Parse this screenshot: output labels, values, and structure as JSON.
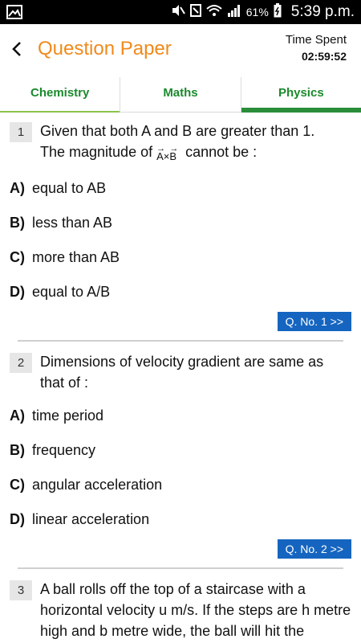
{
  "status_bar": {
    "battery": "61%",
    "time": "5:39 p.m."
  },
  "header": {
    "title": "Question Paper",
    "timer_label": "Time Spent",
    "timer_value": "02:59:52"
  },
  "tabs": [
    {
      "label": "Chemistry"
    },
    {
      "label": "Maths"
    },
    {
      "label": "Physics",
      "active": true
    }
  ],
  "questions": [
    {
      "number": "1",
      "text_line1": "Given that both A and B are greater than 1.",
      "text_line2_pre": "The magnitude of",
      "text_line2_vec_a": "A",
      "text_line2_cross": "×",
      "text_line2_vec_b": "B",
      "text_line2_post": "cannot be :",
      "options": [
        {
          "label": "A)",
          "text": "equal to AB"
        },
        {
          "label": "B)",
          "text": "less than AB"
        },
        {
          "label": "C)",
          "text": "more than AB"
        },
        {
          "label": "D)",
          "text": "equal to A/B"
        }
      ],
      "button": "Q. No. 1 >>"
    },
    {
      "number": "2",
      "text": "Dimensions of velocity gradient are same as that of :",
      "options": [
        {
          "label": "A)",
          "text": "time period"
        },
        {
          "label": "B)",
          "text": "frequency"
        },
        {
          "label": "C)",
          "text": "angular acceleration"
        },
        {
          "label": "D)",
          "text": "linear acceleration"
        }
      ],
      "button": "Q. No. 2 >>"
    },
    {
      "number": "3",
      "text": "A ball rolls off the top of a staircase with a horizontal velocity u m/s. If the steps are h metre high and b metre wide, the ball will hit the"
    }
  ],
  "colors": {
    "title": "#f08a1c",
    "tab_text": "#1b8a2c",
    "tab_active_line": "#2a8d3a",
    "button_bg": "#1565c0"
  }
}
